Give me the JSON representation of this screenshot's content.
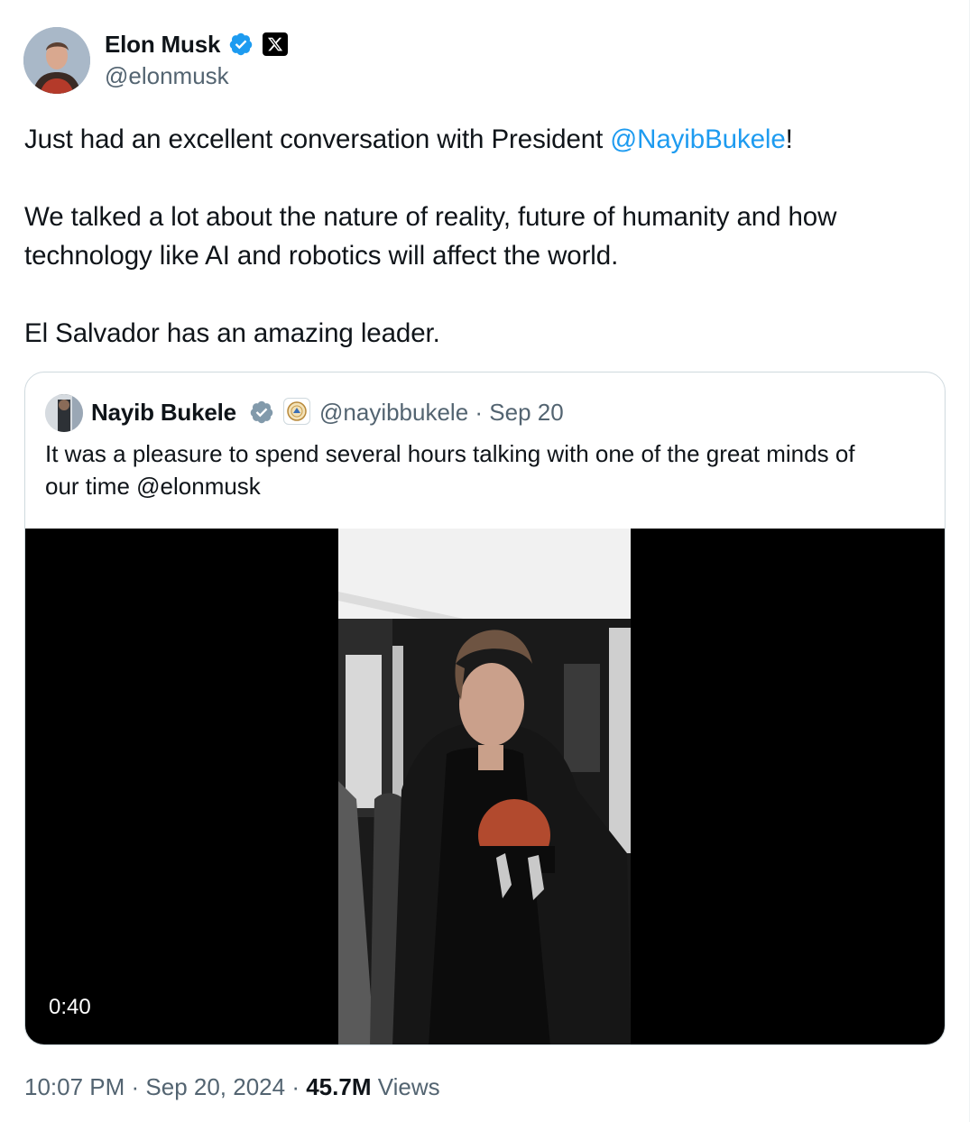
{
  "author": {
    "display_name": "Elon Musk",
    "handle": "@elonmusk",
    "verified": true,
    "affiliate_badge": "x-logo-icon"
  },
  "tweet": {
    "line1_prefix": "Just had an excellent conversation with President ",
    "line1_mention": "@NayibBukele",
    "line1_suffix": "!",
    "line2": "We talked a lot about the nature of reality, future of humanity and how",
    "line3": "technology like AI and robotics will affect the world.",
    "line4": "El Salvador has an amazing leader."
  },
  "quote": {
    "display_name": "Nayib Bukele",
    "verified": true,
    "affiliate_badge": "el-salvador-seal-icon",
    "handle": "@nayibbukele",
    "separator": " · ",
    "date": "Sep 20",
    "text_line1": "It was a pleasure to spend several hours talking with one of the great minds of",
    "text_line2": "our time @elonmusk",
    "video_duration": "0:40"
  },
  "footer": {
    "time": "10:07 PM",
    "separator": " · ",
    "date": "Sep 20, 2024",
    "views_count": "45.7M",
    "views_label": " Views"
  },
  "colors": {
    "link": "#1d9bf0",
    "verified": "#1d9bf0",
    "secondary_text": "#536471",
    "primary_text": "#0f1419"
  }
}
